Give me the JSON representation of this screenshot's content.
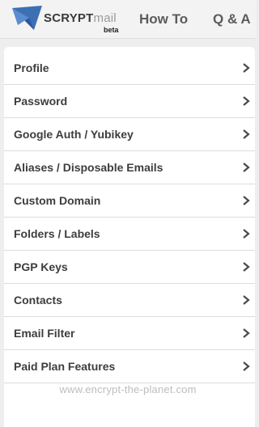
{
  "header": {
    "brand_strong": "SCRYPT",
    "brand_light": "mail",
    "brand_sub": "beta",
    "nav": [
      {
        "label": "How To"
      },
      {
        "label": "Q & A"
      }
    ],
    "logo_icon": "envelope-logo-icon"
  },
  "menu": {
    "items": [
      {
        "label": "Profile"
      },
      {
        "label": "Password"
      },
      {
        "label": "Google Auth / Yubikey"
      },
      {
        "label": "Aliases / Disposable Emails"
      },
      {
        "label": "Custom Domain"
      },
      {
        "label": "Folders / Labels"
      },
      {
        "label": "PGP Keys"
      },
      {
        "label": "Contacts"
      },
      {
        "label": "Email Filter"
      },
      {
        "label": "Paid Plan Features"
      }
    ]
  },
  "footer": {
    "watermark": "www.encrypt-the-planet.com"
  },
  "colors": {
    "background": "#eeeeee",
    "logo_blue": "#3d6fb4",
    "text": "#3d3d3d"
  }
}
